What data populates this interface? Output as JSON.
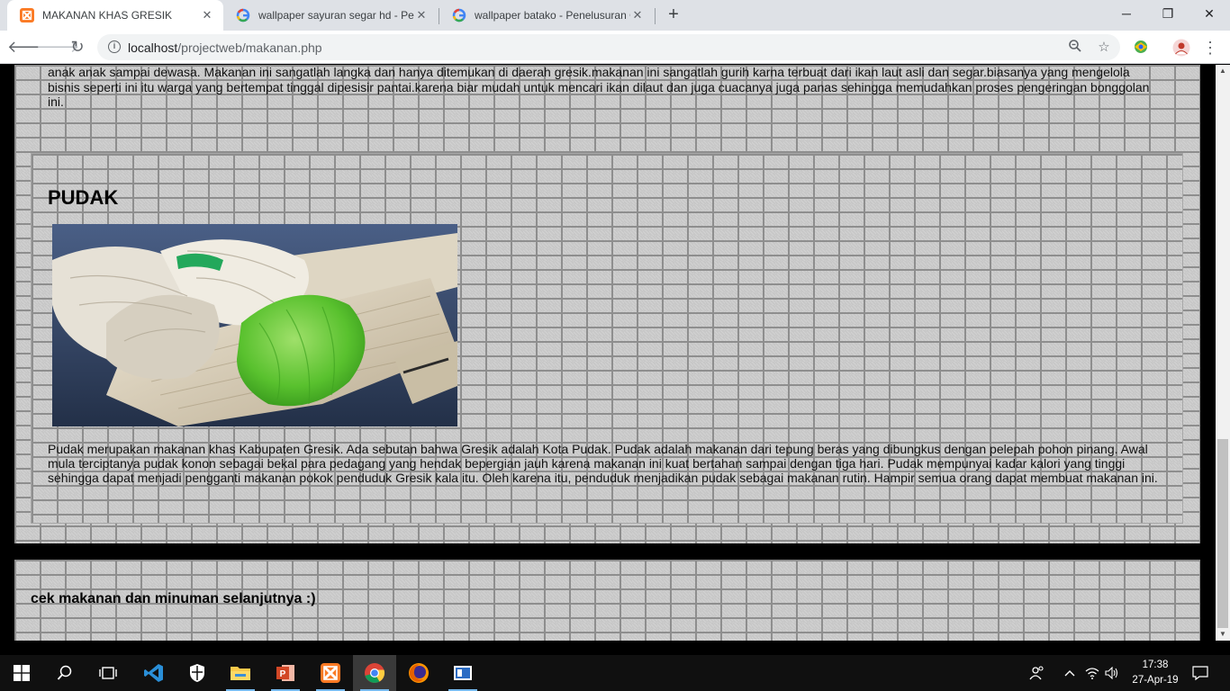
{
  "browser": {
    "tabs": [
      {
        "title": "MAKANAN KHAS GRESIK",
        "active": true,
        "favicon": "xampp-icon"
      },
      {
        "title": "wallpaper sayuran segar hd - Pen",
        "active": false,
        "favicon": "google-icon"
      },
      {
        "title": "wallpaper batako - Penelusuran G",
        "active": false,
        "favicon": "google-icon"
      }
    ],
    "new_tab": "+",
    "window_controls": {
      "minimize": "─",
      "restore": "❐",
      "close": "✕"
    },
    "url_host": "localhost",
    "url_path": "/projectweb/makanan.php"
  },
  "page": {
    "top_paragraph": "anak anak sampai dewasa. Makanan ini sangatlah langka dan hanya ditemukan di daerah gresik.makanan ini sangatlah gurih karna terbuat dari ikan laut asli dan segar.biasanya yang mengelola bisnis seperti ini itu warga yang bertempat tinggal dipesisir pantai.karena biar mudah untuk mencari ikan dilaut dan juga cuacanya juga panas sehingga memudahkan proses pengeringan bonggolan ini.",
    "card": {
      "title": "PUDAK",
      "description": "Pudak merupakan makanan khas Kabupaten Gresik. Ada sebutan bahwa Gresik adalah Kota Pudak. Pudak adalah makanan dari tepung beras yang dibungkus dengan pelepah pohon pinang. Awal mula terciptanya pudak konon sebagai bekal para pedagang yang hendak bepergian jauh karena makanan ini kuat bertahan sampai dengan tiga hari. Pudak mempunyai kadar kalori yang tinggi sehingga dapat menjadi pengganti makanan pokok penduduk Gresik kala itu. Oleh karena itu, penduduk menjadikan pudak sebagai makanan rutin. Hampir semua orang dapat membuat makanan ini."
    },
    "footer_text": "cek makanan dan minuman selanjutnya :)"
  },
  "taskbar": {
    "apps": [
      "windows-start-icon",
      "search-icon",
      "task-view-icon",
      "vscode-icon",
      "windows-security-icon",
      "file-explorer-icon",
      "powerpoint-icon",
      "xampp-icon",
      "chrome-icon",
      "firefox-icon",
      "remote-app-icon"
    ],
    "clock_time": "17:38",
    "clock_date": "27-Apr-19"
  },
  "colors": {
    "accent": "#76b9ed",
    "xampp_orange": "#fb7a24"
  }
}
